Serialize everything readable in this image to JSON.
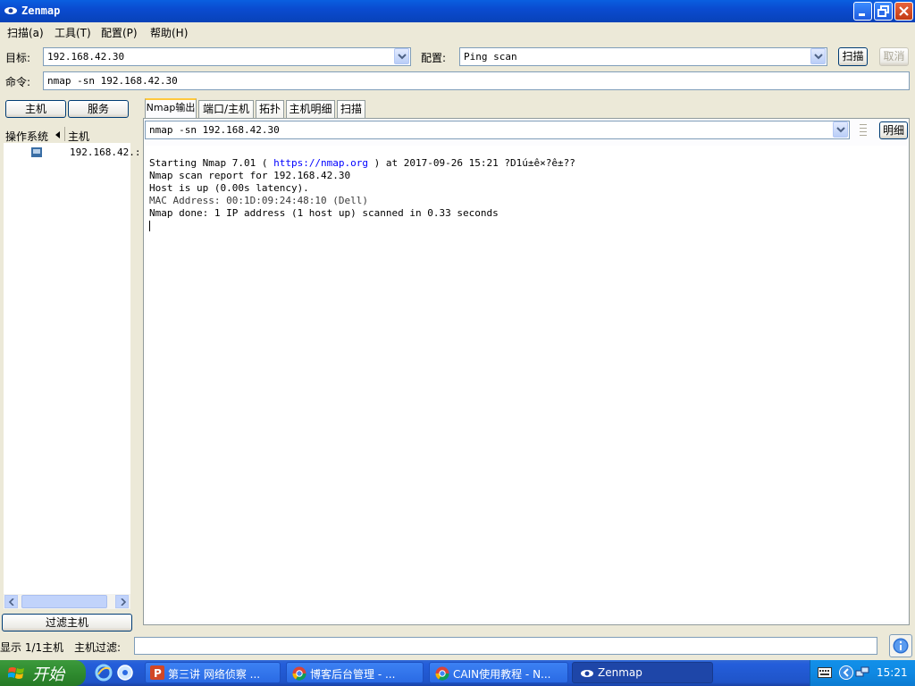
{
  "window": {
    "title": "Zenmap",
    "icon": "zenmap-eye-icon"
  },
  "menu": [
    {
      "label": "扫描(a)"
    },
    {
      "label": "工具(T)"
    },
    {
      "label": "配置(P)"
    },
    {
      "label": "帮助(H)"
    }
  ],
  "toolbar": {
    "target_label": "目标:",
    "target_value": "192.168.42.30",
    "profile_label": "配置:",
    "profile_value": "Ping scan",
    "scan_button": "扫描",
    "cancel_button": "取消",
    "command_label": "命令:",
    "command_value": "nmap -sn 192.168.42.30"
  },
  "left_pane": {
    "hosts_button": "主机",
    "services_button": "服务",
    "col_os": "操作系统",
    "col_host": "主机",
    "hosts": [
      {
        "name": "192.168.42.:"
      }
    ],
    "filter_button": "过滤主机"
  },
  "tabs": [
    {
      "label": "Nmap输出"
    },
    {
      "label": "端口/主机"
    },
    {
      "label": "拓扑"
    },
    {
      "label": "主机明细"
    },
    {
      "label": "扫描"
    }
  ],
  "output": {
    "select_value": "nmap -sn 192.168.42.30",
    "details_button": "明细",
    "lines": [
      "Starting Nmap 7.01 ( ",
      "https://nmap.org",
      " ) at 2017-09-26 15:21 ?D1ú±ê×?ê±??",
      "Nmap scan report for 192.168.42.30",
      "Host is up (0.00s latency).",
      "MAC Address: 00:1D:09:24:48:10 (Dell)",
      "Nmap done: 1 IP address (1 host up) scanned in 0.33 seconds"
    ],
    "link_color": "#0000ff"
  },
  "statusbar": {
    "showing": "显示 1/1主机",
    "filter_label": "主机过滤:",
    "filter_value": ""
  },
  "taskbar": {
    "start_label": "开始",
    "items": [
      {
        "label": "第三讲 网络侦察 ..."
      },
      {
        "label": "博客后台管理 - ..."
      },
      {
        "label": "CAIN使用教程 - N..."
      },
      {
        "label": "Zenmap"
      }
    ],
    "clock": "15:21"
  }
}
